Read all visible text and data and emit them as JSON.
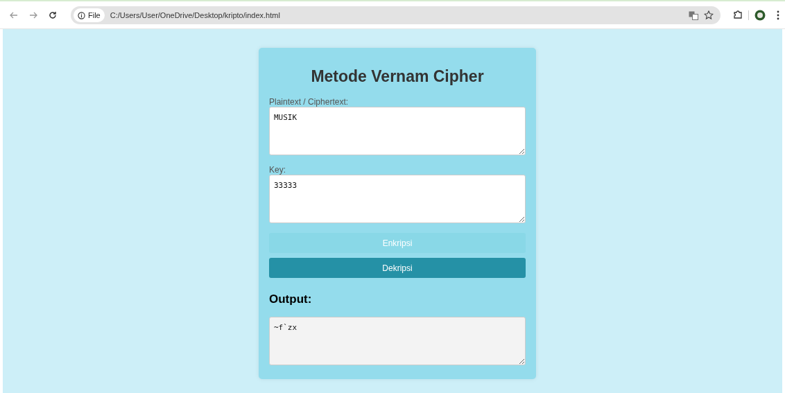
{
  "browser": {
    "security_chip": "File",
    "address": "C:/Users/User/OneDrive/Desktop/kripto/index.html"
  },
  "form": {
    "title": "Metode Vernam Cipher",
    "fields": [
      {
        "label": "Plaintext / Ciphertext:",
        "value": "MUSIK",
        "readonly": false
      },
      {
        "label": "Key:",
        "value": "33333",
        "readonly": false
      }
    ],
    "buttons": [
      {
        "label": "Enkripsi",
        "disabled": true
      },
      {
        "label": "Dekripsi",
        "disabled": false
      }
    ],
    "output": {
      "heading": "Output:",
      "value": "~f`zx",
      "readonly": true
    }
  }
}
